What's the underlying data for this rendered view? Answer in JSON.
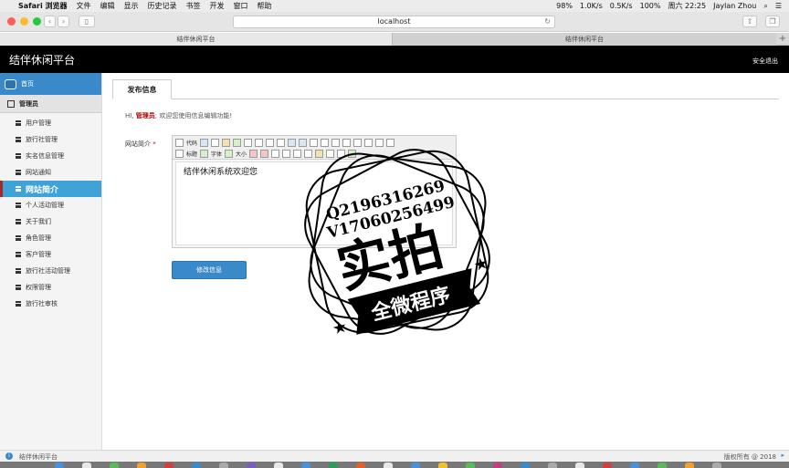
{
  "menubar": {
    "app": "Safari 浏览器",
    "items": [
      "文件",
      "编辑",
      "显示",
      "历史记录",
      "书签",
      "开发",
      "窗口",
      "帮助"
    ],
    "battery": "98%",
    "net_up": "1.0K/s",
    "net_down": "0.5K/s",
    "percent2": "100%",
    "clock": "周六 22:25",
    "user": "Jaylan Zhou"
  },
  "browser": {
    "url": "localhost",
    "tabs": [
      "结伴休闲平台",
      "结伴休闲平台"
    ]
  },
  "header": {
    "title": "结伴休闲平台",
    "logout": "安全退出"
  },
  "sidebar": {
    "home": "首页",
    "group": "管理员",
    "items": [
      {
        "label": "用户管理"
      },
      {
        "label": "旅行社管理"
      },
      {
        "label": "实名信息管理"
      },
      {
        "label": "网站通知"
      },
      {
        "label": "网站简介"
      },
      {
        "label": "个人活动管理"
      },
      {
        "label": "关于我们"
      },
      {
        "label": "角色管理"
      },
      {
        "label": "客户管理"
      },
      {
        "label": "旅行社活动管理"
      },
      {
        "label": "权限管理"
      },
      {
        "label": "旅行社审核"
      }
    ]
  },
  "main": {
    "tab": "发布信息",
    "greeting_prefix": "HI,",
    "greeting_admin": "管理员",
    "greeting_suffix": "; 欢迎您使用信息编辑功能!",
    "field_label": "网站简介",
    "required": "*",
    "toolbar": {
      "code": "代码",
      "heading": "标题",
      "font": "字体",
      "size": "大小"
    },
    "editor_content": "结伴休闲系统欢迎您",
    "submit": "修改信息"
  },
  "stamp": {
    "qq": "Q2196316269",
    "vx": "V17060256499",
    "big": "实拍",
    "banner": "全微程序"
  },
  "footer": {
    "left": "结伴休闲平台",
    "right": "版权所有 @ 2018"
  }
}
